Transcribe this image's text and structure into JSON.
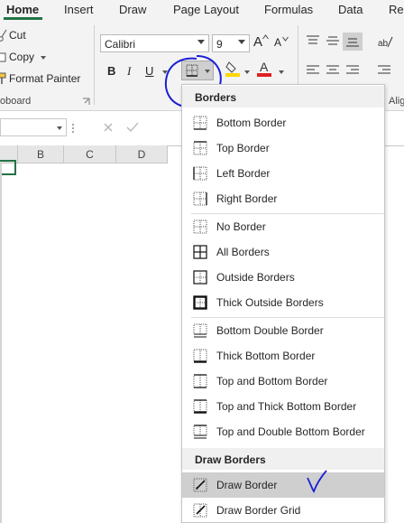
{
  "ribbon_tabs": [
    "Home",
    "Insert",
    "Draw",
    "Page Layout",
    "Formulas",
    "Data",
    "Re"
  ],
  "clipboard": {
    "cut_label": "Cut",
    "copy_label": "Copy",
    "format_painter_label": "Format Painter",
    "group_label": "oboard"
  },
  "font": {
    "font_name": "Calibri",
    "font_size": "9",
    "bold": "B",
    "italic": "I",
    "underline": "U",
    "grow_font": "A",
    "shrink_font": "A"
  },
  "alignment": {
    "group_label": "Alig"
  },
  "grid": {
    "columns": [
      "B",
      "C",
      "D"
    ]
  },
  "borders_menu": {
    "header": "Borders",
    "items_group1": [
      "Bottom Border",
      "Top Border",
      "Left Border",
      "Right Border"
    ],
    "items_group2": [
      "No Border",
      "All Borders",
      "Outside Borders",
      "Thick Outside Borders"
    ],
    "items_group3": [
      "Bottom Double Border",
      "Thick Bottom Border",
      "Top and Bottom Border",
      "Top and Thick Bottom Border",
      "Top and Double Bottom Border"
    ],
    "draw_header": "Draw Borders",
    "draw_items": [
      "Draw Border",
      "Draw Border Grid"
    ]
  },
  "colors": {
    "accent": "#217346",
    "annotation": "#1a1fd6",
    "font_color_bar": "#e02020",
    "highlight_bar": "#ffd700"
  }
}
